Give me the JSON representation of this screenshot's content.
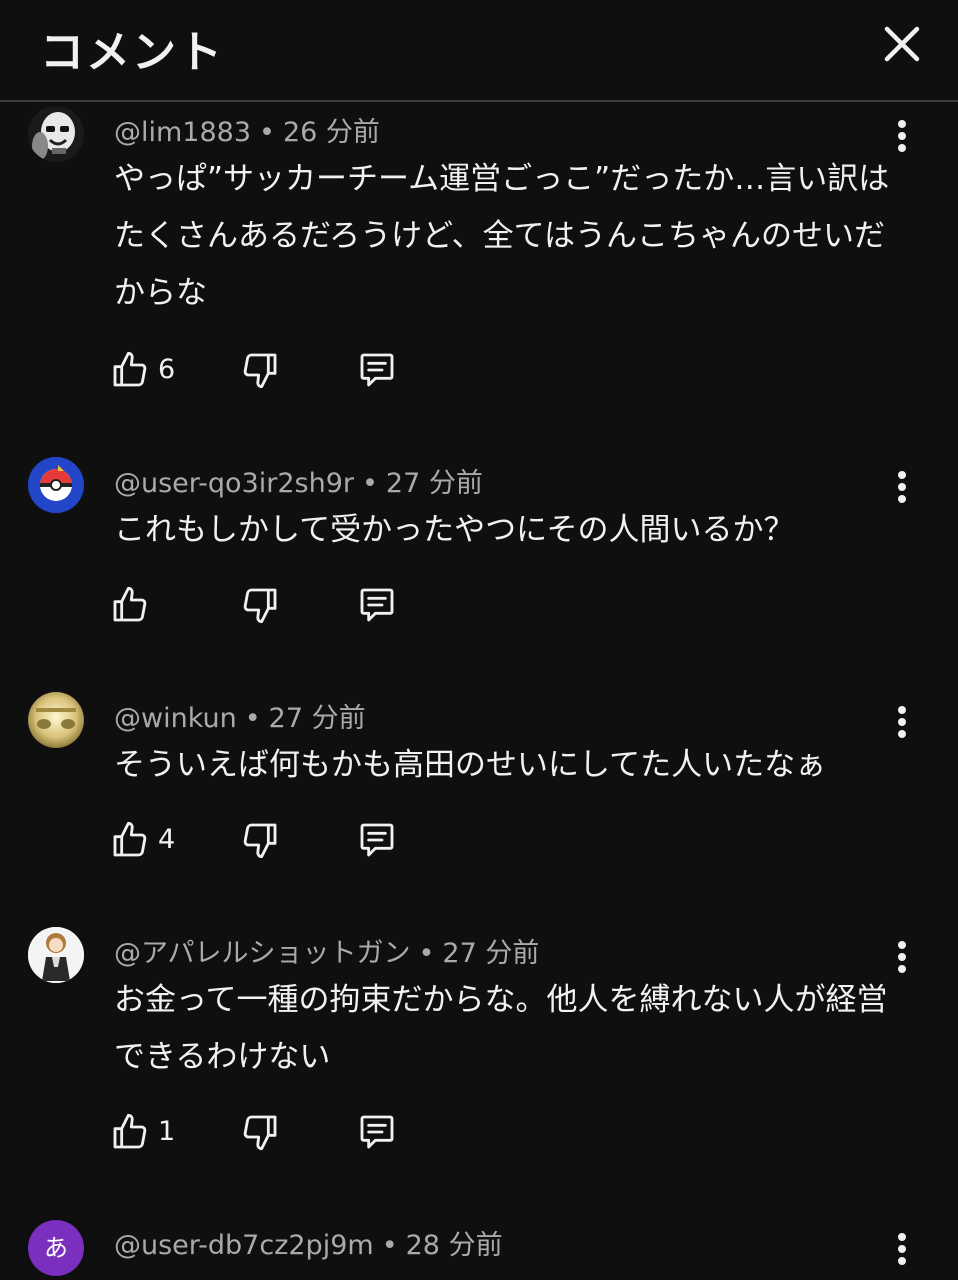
{
  "header": {
    "title": "コメント",
    "close_icon": "close-icon"
  },
  "colors": {
    "background": "#0f0f0f",
    "text": "#f1f1f1",
    "secondary": "#aaaaaa",
    "divider": "#3a3a3a",
    "avatar5": "#7b2fbf"
  },
  "comments": [
    {
      "handle": "@lim1883",
      "sep": "•",
      "time": "26 分前",
      "text": "やっぱ”サッカーチーム運営ごっこ”だったか…言い訳はたくさんあるだろうけど、全てはうんこちゃんのせいだからな",
      "likes": "6"
    },
    {
      "handle": "@user-qo3ir2sh9r",
      "sep": "•",
      "time": "27 分前",
      "text": "これもしかして受かったやつにその人間いるか？",
      "likes": ""
    },
    {
      "handle": "@winkun",
      "sep": "•",
      "time": "27 分前",
      "text": "そういえば何もかも高田のせいにしてた人いたなぁ",
      "likes": "4"
    },
    {
      "handle": "@アパレルショットガン",
      "sep": "•",
      "time": "27 分前",
      "text": "お金って一種の拘束だからな。他人を縛れない人が経営できるわけない",
      "likes": "1"
    },
    {
      "handle": "@user-db7cz2pj9m",
      "sep": "•",
      "time": "28 分前",
      "avatar_letter": "あ"
    }
  ]
}
